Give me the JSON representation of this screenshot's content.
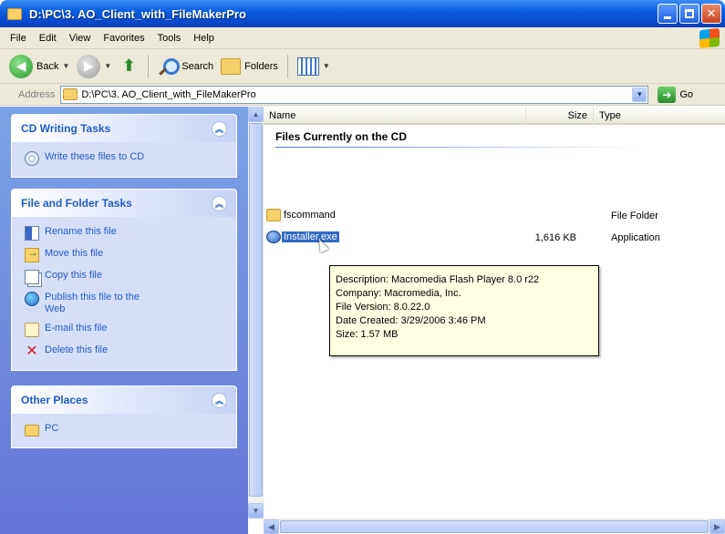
{
  "window": {
    "title": "D:\\PC\\3. AO_Client_with_FileMakerPro"
  },
  "menu": [
    "File",
    "Edit",
    "View",
    "Favorites",
    "Tools",
    "Help"
  ],
  "toolbar": {
    "back_label": "Back",
    "search_label": "Search",
    "folders_label": "Folders"
  },
  "address": {
    "label": "Address",
    "value": "D:\\PC\\3. AO_Client_with_FileMakerPro",
    "go_label": "Go"
  },
  "taskpane": {
    "cd_tasks": {
      "title": "CD Writing Tasks",
      "items": [
        {
          "label": "Write these files to CD",
          "icon": "cd-icon"
        }
      ]
    },
    "file_tasks": {
      "title": "File and Folder Tasks",
      "items": [
        {
          "label": "Rename this file",
          "icon": "rename-icon"
        },
        {
          "label": "Move this file",
          "icon": "move-icon"
        },
        {
          "label": "Copy this file",
          "icon": "copy-icon"
        },
        {
          "label": "Publish this file to the Web",
          "icon": "globe-icon"
        },
        {
          "label": "E-mail this file",
          "icon": "email-icon"
        },
        {
          "label": "Delete this file",
          "icon": "delete-icon"
        }
      ]
    },
    "other_places": {
      "title": "Other Places",
      "items": [
        {
          "label": "PC",
          "icon": "folder-icon"
        }
      ]
    }
  },
  "filelist": {
    "columns": {
      "name": "Name",
      "size": "Size",
      "type": "Type"
    },
    "group_title": "Files Currently on the CD",
    "rows": [
      {
        "name": "fscommand",
        "size": "",
        "type": "File Folder",
        "icon": "folder-icon",
        "selected": false
      },
      {
        "name": "Installer.exe",
        "size": "1,616 KB",
        "type": "Application",
        "icon": "application-icon",
        "selected": true
      }
    ]
  },
  "tooltip": {
    "description": "Description: Macromedia Flash Player 8.0  r22",
    "company": "Company: Macromedia, Inc.",
    "version": "File Version: 8.0.22.0",
    "created": "Date Created: 3/29/2006 3:46 PM",
    "size": "Size: 1.57 MB"
  },
  "colors": {
    "titlebar": "#0a5fe0",
    "taskpane_bg": "#7ba2e7",
    "link": "#215dc6",
    "selection": "#316ac5",
    "tooltip_bg": "#ffffe1"
  }
}
